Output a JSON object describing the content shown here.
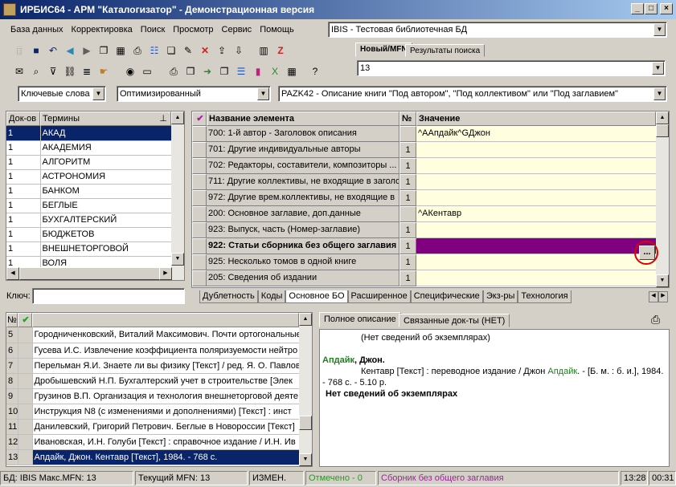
{
  "window": {
    "title": "ИРБИС64 - АРМ \"Каталогизатор\" - Демонстрационная версия"
  },
  "menu": [
    "База данных",
    "Корректировка",
    "Поиск",
    "Просмотр",
    "Сервис",
    "Помощь"
  ],
  "database_combo": "IBIS - Тестовая библиотечная БД",
  "top_tabs": [
    "Новый/MFN",
    "Результаты поиска"
  ],
  "mfn_value": "13",
  "search_bar": {
    "mode": "Ключевые слова",
    "optimization": "Оптимизированный",
    "worksheet": "PAZK42 - Описание книги \"Под автором\", \"Под коллективом\" или \"Под заглавием\""
  },
  "dictionary": {
    "col_docs": "Док-ов",
    "col_terms": "Термины",
    "rows": [
      {
        "n": "1",
        "t": "АКАД"
      },
      {
        "n": "1",
        "t": "АКАДЕМИЯ"
      },
      {
        "n": "1",
        "t": "АЛГОРИТМ"
      },
      {
        "n": "1",
        "t": "АСТРОНОМИЯ"
      },
      {
        "n": "1",
        "t": "БАНКОМ"
      },
      {
        "n": "1",
        "t": "БЕГЛЫЕ"
      },
      {
        "n": "1",
        "t": "БУХГАЛТЕРСКИЙ"
      },
      {
        "n": "1",
        "t": "БЮДЖЕТОВ"
      },
      {
        "n": "1",
        "t": "ВНЕШНЕТОРГОВОЙ"
      },
      {
        "n": "1",
        "t": "ВОЛЯ"
      }
    ],
    "key_label": "Ключ:"
  },
  "editor": {
    "col_name": "Название элемента",
    "col_num": "№",
    "col_value": "Значение",
    "rows": [
      {
        "name": "700: 1-й автор - Заголовок описания",
        "num": "",
        "value": "^AАпдайк^GДжон"
      },
      {
        "name": "701: Другие индивидуальные авторы",
        "num": "1",
        "value": ""
      },
      {
        "name": "702: Редакторы, составители, композиторы ...",
        "num": "1",
        "value": ""
      },
      {
        "name": "711: Другие коллективы, не входящие в заголо",
        "num": "1",
        "value": ""
      },
      {
        "name": "972: Другие врем.коллективы, не входящие в",
        "num": "1",
        "value": ""
      },
      {
        "name": "200: Основное заглавие, доп.данные",
        "num": "",
        "value": "^AКентавр"
      },
      {
        "name": "923: Выпуск, часть (Номер-заглавие)",
        "num": "1",
        "value": ""
      },
      {
        "name": "922: Статьи сборника без общего заглавия",
        "num": "1",
        "value": ""
      },
      {
        "name": "925: Несколько томов в одной книге",
        "num": "1",
        "value": ""
      },
      {
        "name": "205: Сведения об издании",
        "num": "1",
        "value": ""
      }
    ],
    "ellipsis": "...",
    "tabs": [
      "Дублетность",
      "Коды",
      "Основное БО",
      "Расширенное",
      "Специфические",
      "Экз-ры",
      "Технология"
    ]
  },
  "results": {
    "col_num": "№",
    "rows": [
      {
        "n": "5",
        "t": "Городниченковский, Виталий Максимович. Почти ортогональные"
      },
      {
        "n": "6",
        "t": "Гусева И.С. Извлечение коэффициента поляризуемости нейтро"
      },
      {
        "n": "7",
        "t": "Перельман Я.И. Знаете ли вы физику [Текст] / ред. Я. О. Павлов"
      },
      {
        "n": "8",
        "t": "Дробышевский Н.П. Бухгалтерский учет в строительстве [Элек"
      },
      {
        "n": "9",
        "t": "Грузинов В.П. Организация и технология внешнеторговой деяте"
      },
      {
        "n": "10",
        "t": "Инструкция N8   (с изменениями и дополнениями) [Текст] : инст"
      },
      {
        "n": "11",
        "t": "Данилевский, Григорий Петрович. Беглые в Новороссии [Текст]"
      },
      {
        "n": "12",
        "t": "Ивановская, И.Н. Голуби [Текст] : справочное издание / И.Н. Ив"
      },
      {
        "n": "13",
        "t": "Апдайк, Джон. Кентавр [Текст], 1984. - 768 с."
      }
    ]
  },
  "description": {
    "tabs": [
      "Полное описание",
      "Связанные док-ты (НЕТ)"
    ],
    "line1": "(Нет сведений об экземплярах)",
    "author": "Апдайк",
    "author_rest": ", Джон.",
    "body_a": "Кентавр [Текст] : переводное издание / Джон ",
    "body_author": "Апдайк",
    "body_b": ". - [Б. м. : б. и.], 1984.",
    "body_c": "- 768 с. - 5.10 р.",
    "no_copies": "Нет сведений об экземплярах"
  },
  "statusbar": {
    "db": "БД: IBIS Макс.MFN: 13",
    "mfn": "Текущий MFN: 13",
    "changed": "ИЗМЕН.",
    "marked": "Отмечено - 0",
    "field": "Сборник без общего заглавия",
    "time": "13:28",
    "counter": "00:31"
  }
}
